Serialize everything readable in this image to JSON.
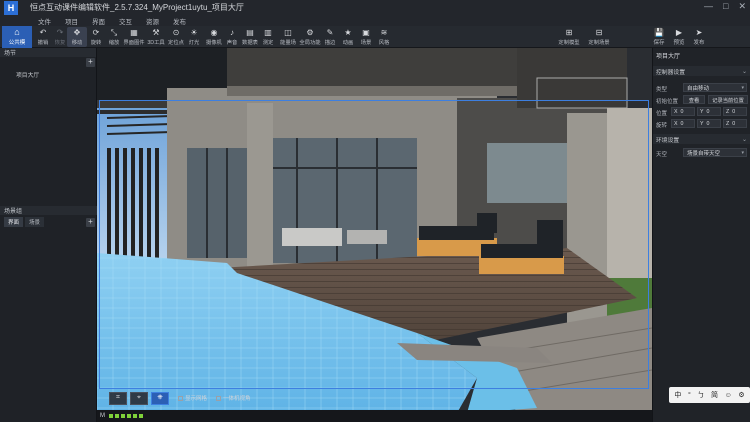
{
  "window": {
    "logo_letter": "H",
    "title": "恒点互动课件编辑软件_2.5.7.324_MyProject1uytu_项目大厅",
    "controls": [
      "—",
      "□",
      "✕"
    ]
  },
  "menu": [
    "文件",
    "项目",
    "界面",
    "交互",
    "资源",
    "发布"
  ],
  "toolbar": {
    "home": {
      "icon": "⌂",
      "label": "公共模"
    },
    "items": [
      {
        "icon": "↶",
        "label": "撤销",
        "dim": false
      },
      {
        "icon": "↷",
        "label": "恢复",
        "dim": true
      },
      {
        "icon": "✥",
        "label": "移动",
        "active": true
      },
      {
        "icon": "⟳",
        "label": "旋转"
      },
      {
        "icon": "⤡",
        "label": "缩放"
      },
      {
        "icon": "▦",
        "label": "界面图件"
      },
      {
        "icon": "⚒",
        "label": "3D工具"
      },
      {
        "icon": "⊙",
        "label": "定位点"
      },
      {
        "icon": "☀",
        "label": "灯光"
      },
      {
        "icon": "◉",
        "label": "摄像机"
      },
      {
        "icon": "♪",
        "label": "声音"
      },
      {
        "icon": "▤",
        "label": "数据表"
      },
      {
        "icon": "▥",
        "label": "测定"
      },
      {
        "icon": "◫",
        "label": "能量场"
      },
      {
        "icon": "⚙",
        "label": "全局功能"
      },
      {
        "icon": "✎",
        "label": "描边"
      },
      {
        "icon": "★",
        "label": "动画"
      },
      {
        "icon": "▣",
        "label": "场景"
      },
      {
        "icon": "≋",
        "label": "风格"
      }
    ],
    "center_buttons": [
      {
        "icon": "⊞",
        "label": "定制模型"
      },
      {
        "icon": "⊟",
        "label": "定制场景"
      }
    ]
  },
  "right_tools": [
    {
      "icon": "💾",
      "label": "保存"
    },
    {
      "icon": "▶",
      "label": "预览"
    },
    {
      "icon": "➤",
      "label": "发布"
    }
  ],
  "left_panel": {
    "header": "场节",
    "tree": [
      "项目大厅"
    ],
    "section2_header": "场景组",
    "tabs": [
      "界面",
      "场景"
    ]
  },
  "viewport": {
    "bottom_buttons": [
      "⌗",
      "⌖",
      "⎈"
    ],
    "checks": [
      "显示网格",
      "一体机视角"
    ],
    "status_letter": "M",
    "status_blocks": 6
  },
  "right_panel": {
    "title": "项目大厅",
    "section_control": "控制器设置",
    "type_label": "类型",
    "type_value": "自由移动",
    "init_pos_label": "初始位置",
    "btn_view": "查看",
    "btn_record": "记录当前位置",
    "pos_label": "位置",
    "rot_label": "旋转",
    "axes": [
      "X",
      "Y",
      "Z"
    ],
    "pos_values": [
      "0",
      "0",
      "0"
    ],
    "rot_values": [
      "0",
      "0",
      "0"
    ],
    "section_env": "环境设置",
    "sky_label": "天空",
    "sky_value": "场景自带天空"
  },
  "ime": [
    "中",
    "°",
    "ㄅ",
    "简",
    "☺",
    "⚙"
  ],
  "colors": {
    "accent": "#2b5fb5",
    "selection": "#3d7fe0",
    "status_ok": "#7fd23a",
    "pool": "#7fc6ef"
  }
}
